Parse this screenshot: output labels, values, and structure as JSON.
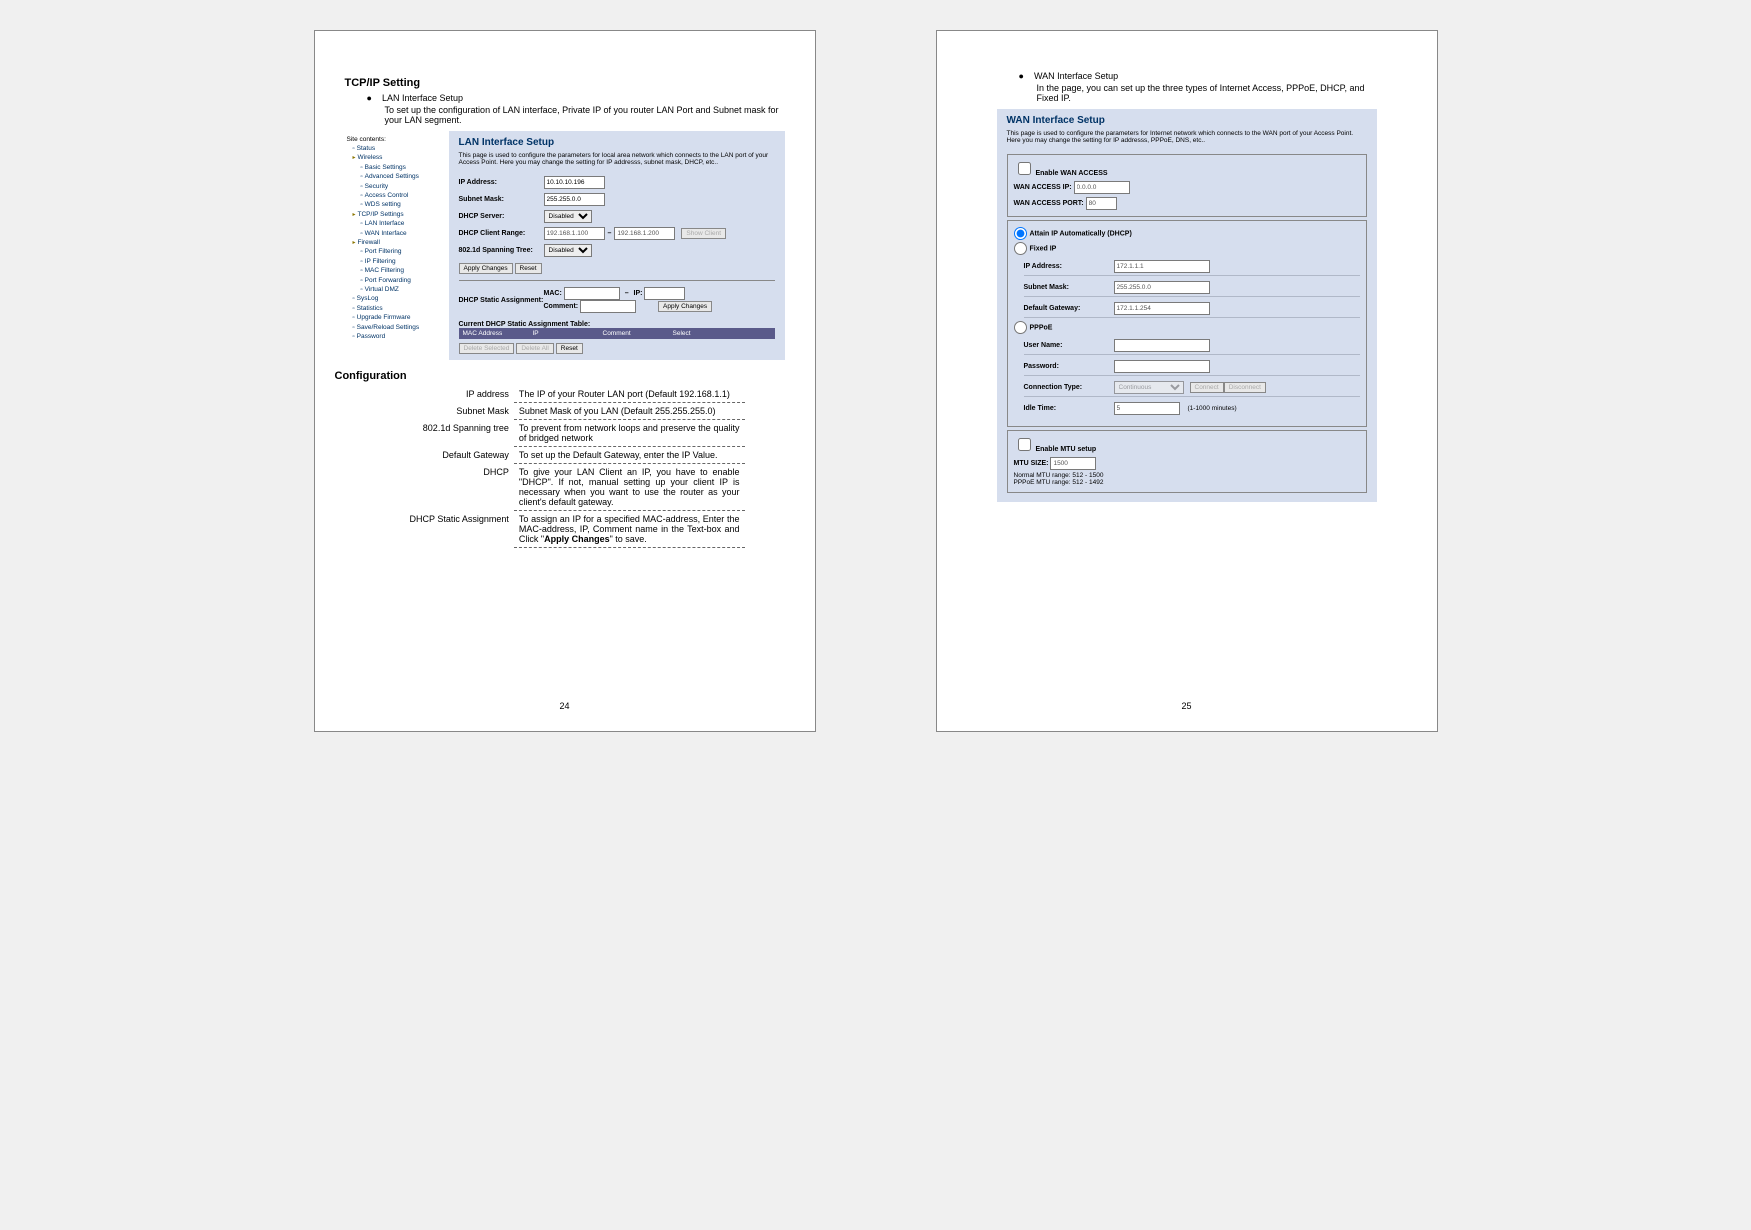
{
  "page1": {
    "num": "24",
    "heading": "TCP/IP Setting",
    "bullet": {
      "title": "LAN Interface Setup",
      "desc": "To set up the configuration of LAN interface, Private IP of you router LAN Port and Subnet mask for your LAN segment."
    },
    "tree": {
      "title": "Site contents:",
      "items": [
        {
          "label": "Status",
          "cls": "l1 doc"
        },
        {
          "label": "Wireless",
          "cls": "l1 folder"
        },
        {
          "label": "Basic Settings",
          "cls": "l2 doc"
        },
        {
          "label": "Advanced Settings",
          "cls": "l2 doc"
        },
        {
          "label": "Security",
          "cls": "l2 doc"
        },
        {
          "label": "Access Control",
          "cls": "l2 doc"
        },
        {
          "label": "WDS setting",
          "cls": "l2 doc"
        },
        {
          "label": "TCP/IP Settings",
          "cls": "l1 folder"
        },
        {
          "label": "LAN Interface",
          "cls": "l2 doc"
        },
        {
          "label": "WAN Interface",
          "cls": "l2 doc"
        },
        {
          "label": "Firewall",
          "cls": "l1 folder"
        },
        {
          "label": "Port Filtering",
          "cls": "l2 doc"
        },
        {
          "label": "IP Filtering",
          "cls": "l2 doc"
        },
        {
          "label": "MAC Filtering",
          "cls": "l2 doc"
        },
        {
          "label": "Port Forwarding",
          "cls": "l2 doc"
        },
        {
          "label": "Virtual DMZ",
          "cls": "l2 doc"
        },
        {
          "label": "SysLog",
          "cls": "l1 doc"
        },
        {
          "label": "Statistics",
          "cls": "l1 doc"
        },
        {
          "label": "Upgrade Firmware",
          "cls": "l1 doc"
        },
        {
          "label": "Save/Reload Settings",
          "cls": "l1 doc"
        },
        {
          "label": "Password",
          "cls": "l1 doc"
        }
      ]
    },
    "panel": {
      "title": "LAN Interface Setup",
      "desc": "This page is used to configure the parameters for local area network which connects to the LAN port of your Access Point. Here you may change the setting for IP addresss, subnet mask, DHCP, etc..",
      "ip_label": "IP Address:",
      "ip_value": "10.10.10.196",
      "mask_label": "Subnet Mask:",
      "mask_value": "255.255.0.0",
      "dhcp_label": "DHCP Server:",
      "dhcp_value": "Disabled",
      "range_label": "DHCP Client Range:",
      "range_from": "192.168.1.100",
      "range_to": "192.168.1.200",
      "show_client": "Show Client",
      "stp_label": "802.1d Spanning Tree:",
      "stp_value": "Disabled",
      "apply": "Apply Changes",
      "reset": "Reset",
      "static_label": "DHCP Static Assignment:",
      "mac_label": "MAC:",
      "iplbl": "IP:",
      "comment_label": "Comment:",
      "table_caption": "Current DHCP Static Assignment Table:",
      "th1": "MAC Address",
      "th2": "IP",
      "th3": "Comment",
      "th4": "Select",
      "del_sel": "Delete Selected",
      "del_all": "Delete All"
    },
    "config": {
      "heading": "Configuration",
      "rows": [
        {
          "k": "IP address",
          "v": "The IP of your Router LAN port (Default 192.168.1.1)"
        },
        {
          "k": "Subnet Mask",
          "v": "Subnet Mask of you LAN (Default 255.255.255.0)"
        },
        {
          "k": "802.1d Spanning tree",
          "v": "To prevent from network loops and preserve the quality of bridged network"
        },
        {
          "k": "Default Gateway",
          "v": "To set up the Default Gateway, enter the IP Value."
        },
        {
          "k": "DHCP",
          "v": "To give your LAN Client an IP, you have to enable \"DHCP\". If not, manual setting up your client IP is necessary when you want to use the router as your client's default gateway."
        },
        {
          "k": "DHCP Static Assignment",
          "v": "To assign an IP for a specified MAC-address, Enter the MAC-address, IP, Comment name in the Text-box and Click \"Apply Changes\" to save."
        }
      ]
    }
  },
  "page2": {
    "num": "25",
    "bullet": {
      "title": "WAN Interface Setup",
      "desc": "In the page, you can set up the three types of Internet Access, PPPoE, DHCP, and Fixed IP."
    },
    "panel": {
      "title": "WAN Interface Setup",
      "desc": "This page is used to configure the parameters for Internet network which connects to the WAN port of your Access Point. Here you may change the setting for IP addresss, PPPoE, DNS, etc..",
      "enable_wan": "Enable WAN ACCESS",
      "wan_ip_label": "WAN ACCESS IP:",
      "wan_ip_value": "0.0.0.0",
      "wan_port_label": "WAN ACCESS PORT:",
      "wan_port_value": "80",
      "radio_dhcp": "Attain IP Automatically (DHCP)",
      "radio_fixed": "Fixed IP",
      "ip_label": "IP Address:",
      "ip_value": "172.1.1.1",
      "mask_label": "Subnet Mask:",
      "mask_value": "255.255.0.0",
      "gw_label": "Default Gateway:",
      "gw_value": "172.1.1.254",
      "radio_pppoe": "PPPoE",
      "user_label": "User Name:",
      "pass_label": "Password:",
      "conn_label": "Connection Type:",
      "conn_value": "Continuous",
      "connect_btn": "Connect",
      "disconnect_btn": "Disconnect",
      "idle_label": "Idle Time:",
      "idle_value": "5",
      "idle_help": "(1-1000 minutes)",
      "enable_mtu": "Enable MTU setup",
      "mtu_label": "MTU SIZE:",
      "mtu_value": "1500",
      "mtu_note1": "Normal MTU range: 512 - 1500",
      "mtu_note2": "PPPoE MTU range: 512 - 1492"
    }
  }
}
